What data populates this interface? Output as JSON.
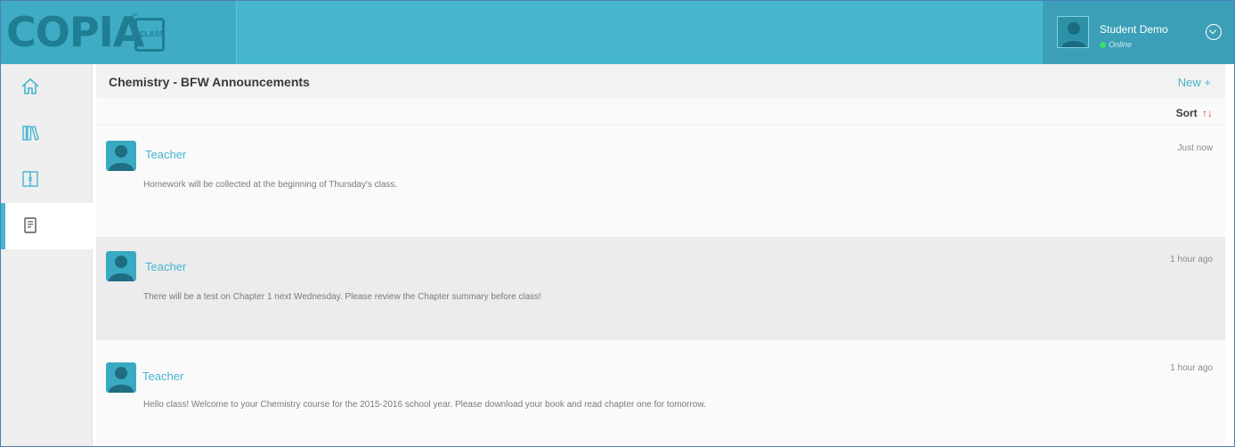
{
  "brand": {
    "logo_text": "COPIA",
    "logo_badge": "CLASS",
    "trademark": "™",
    "primary_color": "#46b6cf",
    "dark_color": "#1f7e92"
  },
  "user": {
    "name": "Student Demo",
    "status": "Online",
    "status_color": "#39e06b",
    "menu_icon": "chevron-circle-down-icon"
  },
  "sidebar": {
    "items": [
      {
        "icon": "home-icon",
        "active": false
      },
      {
        "icon": "library-icon",
        "active": false
      },
      {
        "icon": "book-icon",
        "active": false
      },
      {
        "icon": "announcements-icon",
        "active": true
      }
    ]
  },
  "header": {
    "title": "Chemistry - BFW Announcements",
    "new_label": "New +"
  },
  "sortbar": {
    "label": "Sort",
    "arrows": "↑↓"
  },
  "posts": [
    {
      "author": "Teacher",
      "time": "Just now",
      "body": "Homework will be collected at the beginning of Thursday's class."
    },
    {
      "author": "Teacher",
      "time": "1 hour ago",
      "body": "There will be a test on Chapter 1 next Wednesday. Please review the Chapter summary before class!"
    },
    {
      "author": "Teacher",
      "time": "1 hour ago",
      "body": "Hello class! Welcome to your Chemistry course for the 2015-2016 school year. Please download your book and read chapter one for tomorrow."
    }
  ]
}
